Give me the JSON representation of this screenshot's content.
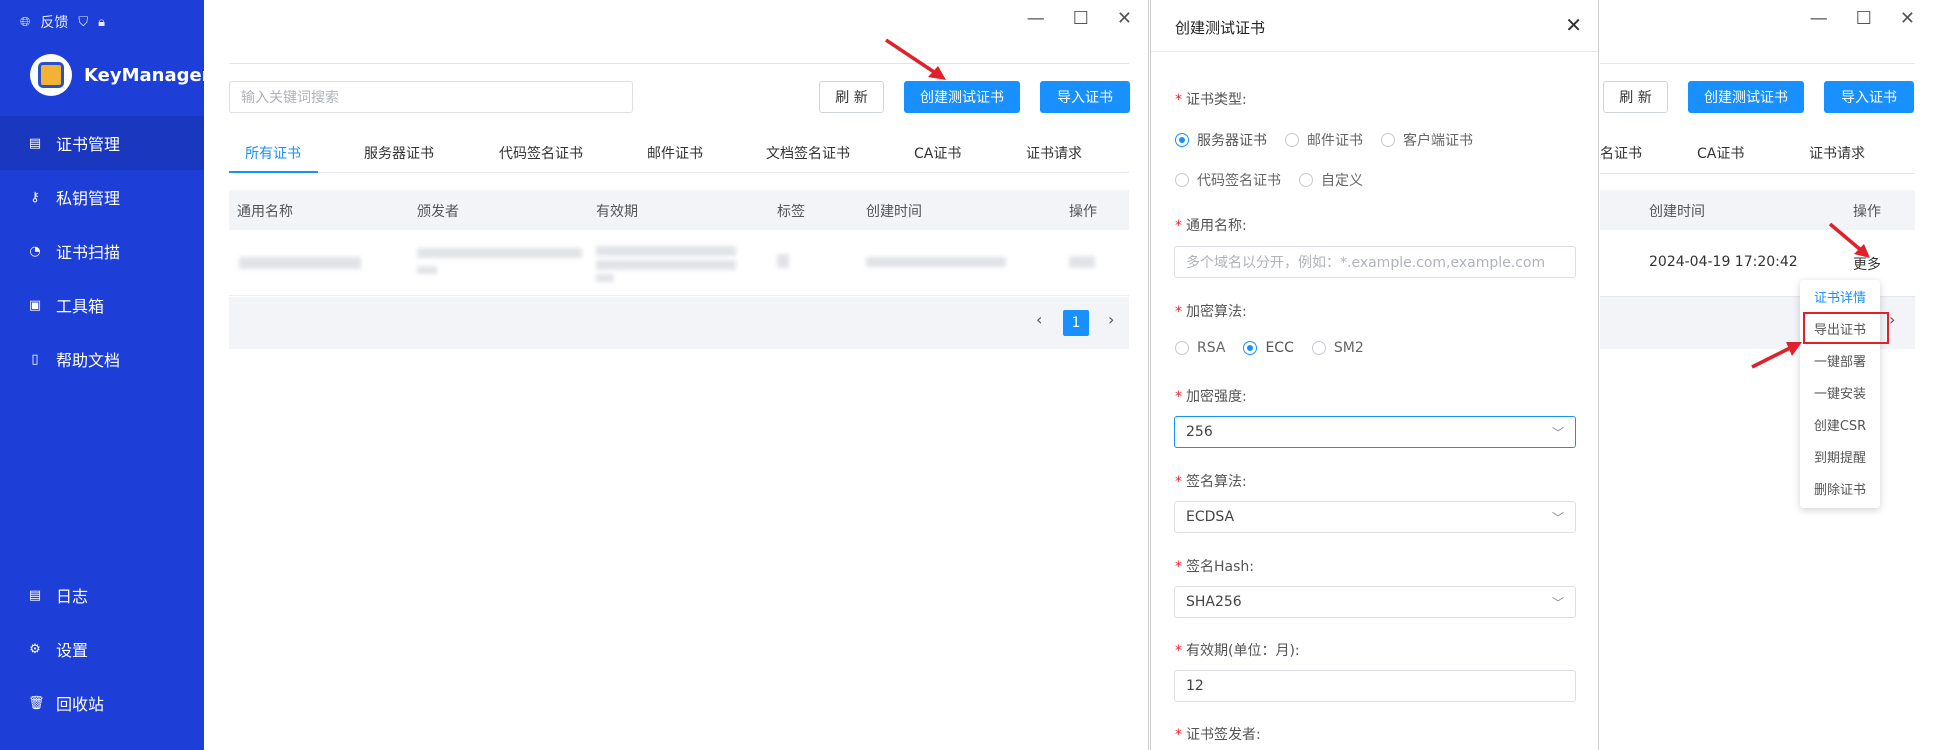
{
  "app": {
    "top_links": {
      "feedback": "反馈"
    },
    "brand": "KeyManager",
    "nav_items": [
      {
        "label": "证书管理",
        "icon": "certificate-icon"
      },
      {
        "label": "私钥管理",
        "icon": "key-icon"
      },
      {
        "label": "证书扫描",
        "icon": "scan-icon"
      },
      {
        "label": "工具箱",
        "icon": "toolbox-icon"
      },
      {
        "label": "帮助文档",
        "icon": "document-icon"
      }
    ],
    "bottom_nav": [
      {
        "label": "日志",
        "icon": "log-icon"
      },
      {
        "label": "设置",
        "icon": "settings-icon"
      },
      {
        "label": "回收站",
        "icon": "trash-icon"
      }
    ],
    "colors": {
      "sidebar": "#1d3fd8",
      "primary": "#1890ff",
      "danger": "#e0202a"
    }
  },
  "cert_window": {
    "search_placeholder": "输入关键词搜索",
    "refresh": "刷 新",
    "create_test": "创建测试证书",
    "import": "导入证书",
    "tabs": [
      "所有证书",
      "服务器证书",
      "代码签名证书",
      "邮件证书",
      "文档签名证书",
      "CA证书",
      "证书请求"
    ],
    "columns": [
      "通用名称",
      "颁发者",
      "有效期",
      "标签",
      "创建时间",
      "操作"
    ],
    "page": "1",
    "prev": "‹",
    "next": "›"
  },
  "dialog": {
    "title": "创建测试证书",
    "close": "✕",
    "cert_type_label": "证书类型:",
    "cert_types": [
      "服务器证书",
      "邮件证书",
      "客户端证书",
      "代码签名证书",
      "自定义"
    ],
    "common_name_label": "通用名称:",
    "common_name_placeholder": "多个域名以分开，例如：*.example.com,example.com",
    "algo_label": "加密算法:",
    "algos": [
      "RSA",
      "ECC",
      "SM2"
    ],
    "strength_label": "加密强度:",
    "strength_value": "256",
    "sign_algo_label": "签名算法:",
    "sign_algo_value": "ECDSA",
    "hash_label": "签名Hash:",
    "hash_value": "SHA256",
    "validity_label": "有效期(单位：月):",
    "validity_value": "12",
    "issuer_label": "证书签发者:"
  },
  "right_window": {
    "refresh": "刷 新",
    "create_test": "创建测试证书",
    "import": "导入证书",
    "tab_partial": "名证书",
    "tabs": [
      "CA证书",
      "证书请求"
    ],
    "columns": [
      "创建时间",
      "操作"
    ],
    "created_at": "2024-04-19 17:20:42",
    "more": "更多",
    "menu_items": [
      "证书详情",
      "导出证书",
      "一键部署",
      "一键安装",
      "创建CSR",
      "到期提醒",
      "删除证书"
    ]
  }
}
